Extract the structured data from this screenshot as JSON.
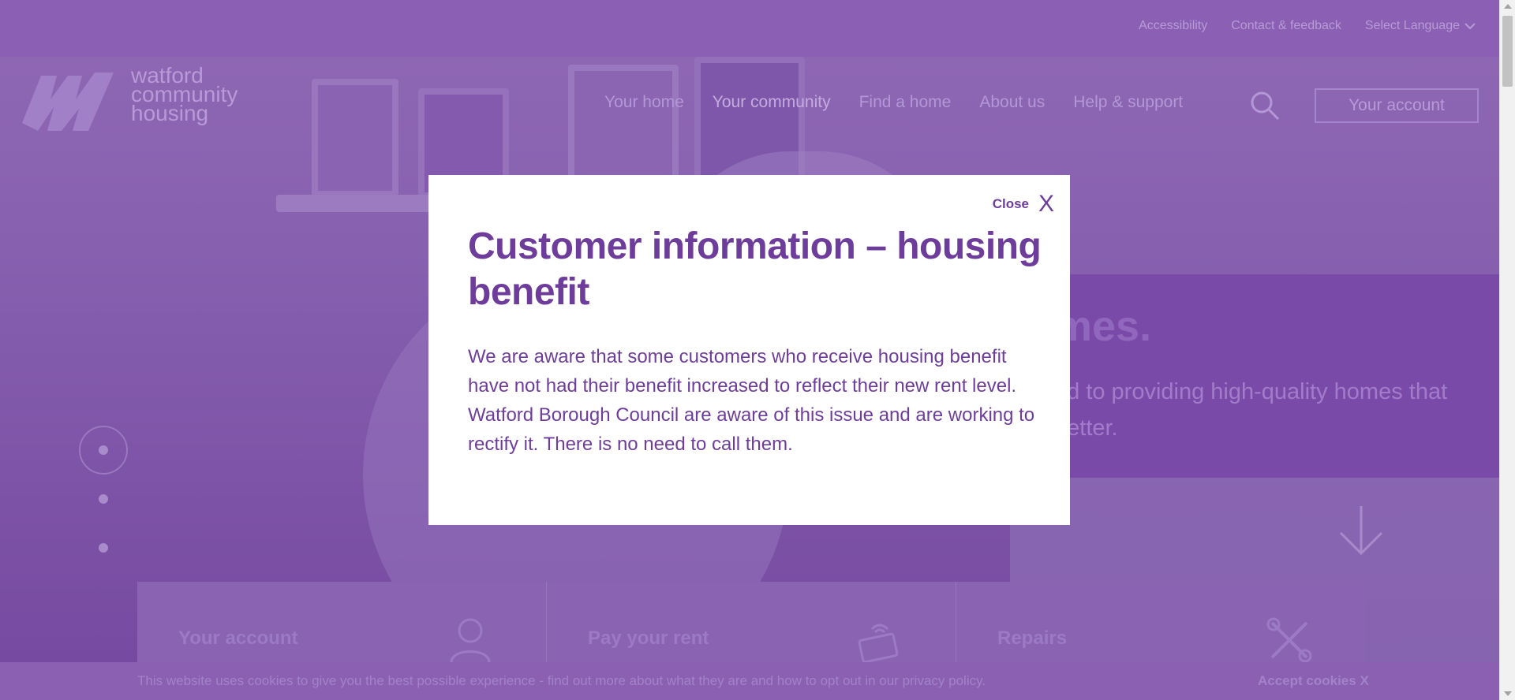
{
  "topbar": {
    "links": [
      "Accessibility",
      "Contact & feedback"
    ],
    "language_select": "Select Language"
  },
  "logo": {
    "lines": [
      "watford",
      "community",
      "housing"
    ]
  },
  "nav": {
    "items": [
      "Your home",
      "Your community",
      "Find a home",
      "About us",
      "Help & support"
    ],
    "active": "Your community",
    "account_button": "Your account"
  },
  "hero": {
    "heading_visible": "mes.",
    "text_visible_line1": "ed to providing high-quality homes that",
    "text_visible_line2": "better."
  },
  "quick_links": [
    {
      "label": "Your account",
      "icon": "person-icon"
    },
    {
      "label": "Pay your rent",
      "icon": "contactless-card-icon"
    },
    {
      "label": "Repairs",
      "icon": "tools-icon"
    }
  ],
  "cookie_bar": {
    "text": "This website uses cookies to give you the best possible experience - find out more about what they are and how to opt out in our privacy policy.",
    "accept": "Accept cookies X"
  },
  "modal": {
    "close_label": "Close",
    "close_x": "X",
    "title": "Customer information – housing benefit",
    "body": "We are aware that some customers who receive housing benefit have not had their benefit increased to reflect their new rent level. Watford Borough Council are aware of this issue and are working to rectify it. There is no need to call them."
  },
  "colors": {
    "brand_purple": "#6e3d9c",
    "overlay_purple": "#7d52a8",
    "modal_bg": "#ffffff"
  }
}
